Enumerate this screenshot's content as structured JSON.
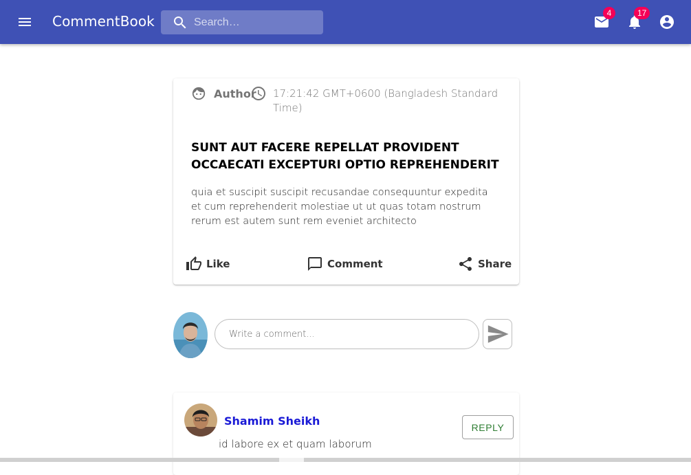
{
  "appbar": {
    "brand": "CommentBook",
    "search_placeholder": "Search…",
    "mail_badge": "4",
    "notifications_badge": "17",
    "color": "#3f51b5",
    "badge_color": "#f50057"
  },
  "post": {
    "author": "Author",
    "timestamp": "17:21:42 GMT+0600 (Bangladesh Standard Time)",
    "title": "SUNT AUT FACERE REPELLAT PROVIDENT OCCAECATI EXCEPTURI OPTIO REPREHENDERIT",
    "body": "quia et suscipit suscipit recusandae consequuntur expedita et cum reprehenderit molestiae ut ut quas totam nostrum rerum est autem sunt rem eveniet architecto",
    "actions": {
      "like": "Like",
      "comment": "Comment",
      "share": "Share"
    }
  },
  "composer": {
    "placeholder": "Write a comment..."
  },
  "comments": [
    {
      "name": "Shamim Sheikh",
      "text": "id labore ex et quam laborum",
      "reply_label": "REPLY"
    }
  ]
}
